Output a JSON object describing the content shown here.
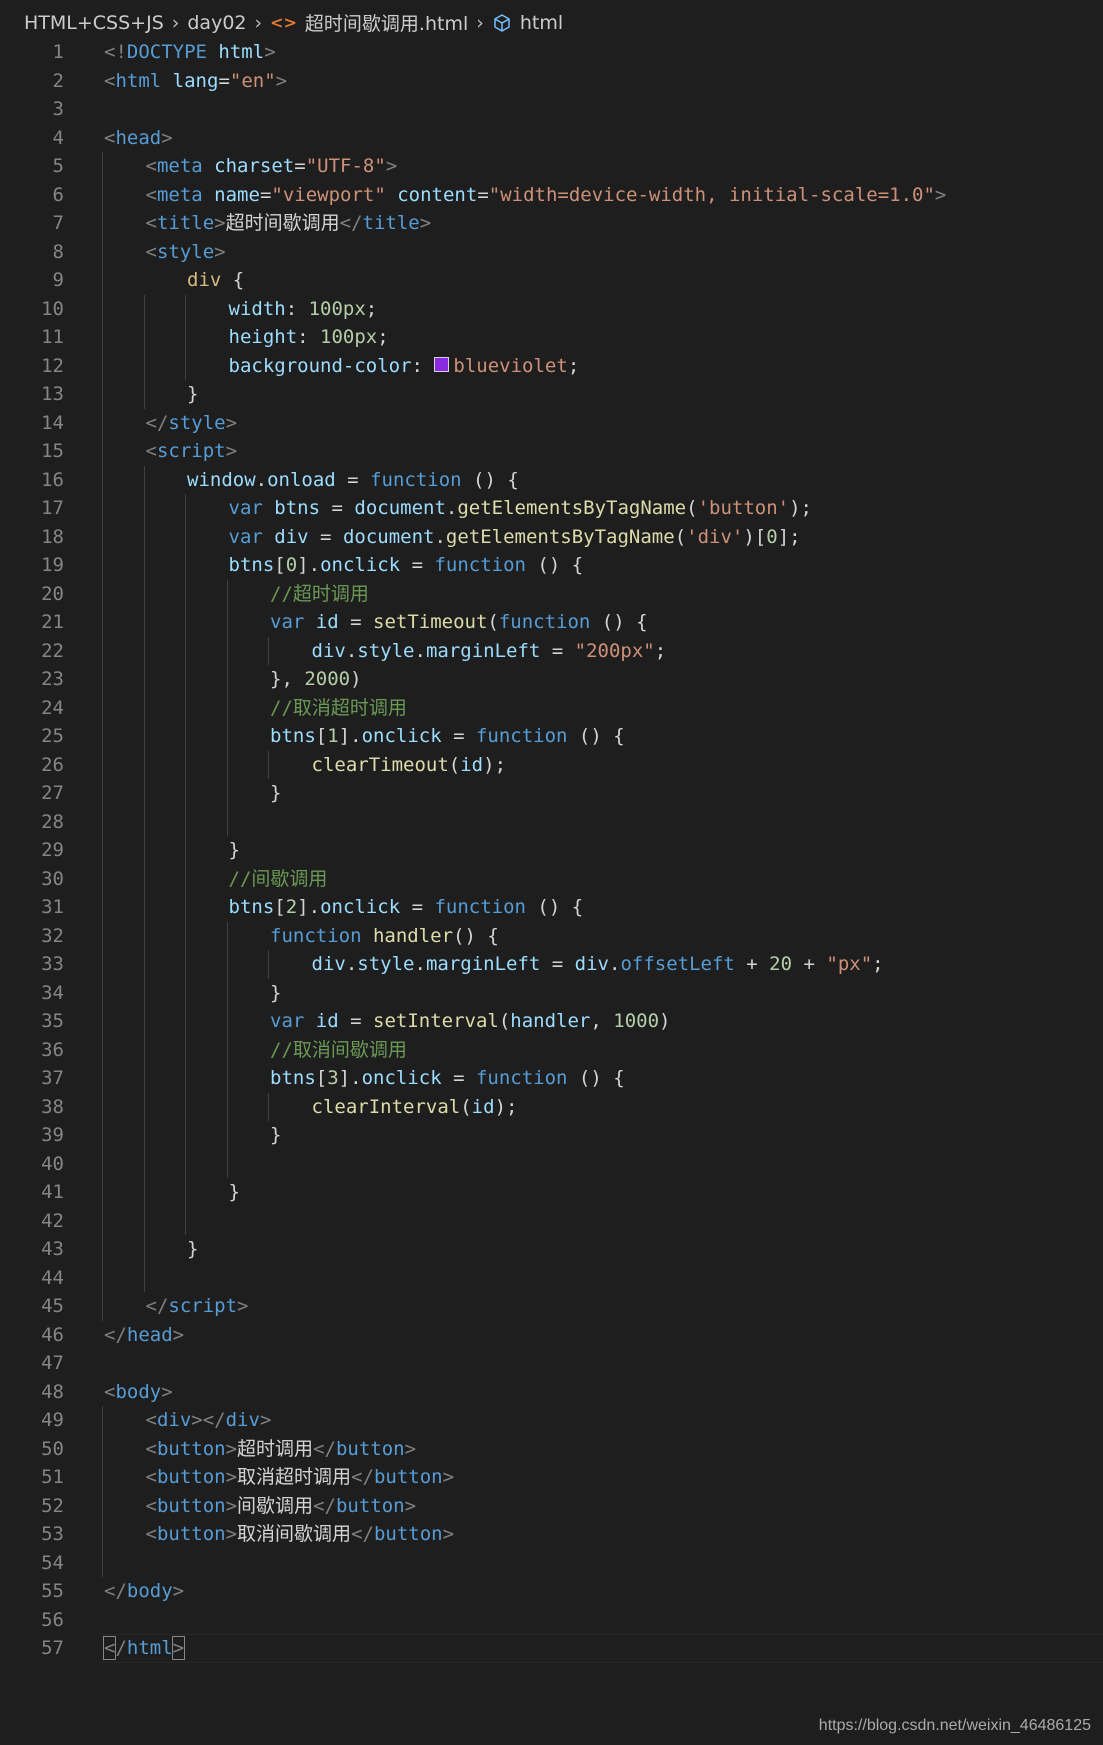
{
  "breadcrumb": {
    "items": [
      "HTML+CSS+JS",
      "day02",
      "超时间歇调用.html",
      "html"
    ],
    "file_icon": "html-file-icon",
    "symbol_icon": "cube-symbol-icon"
  },
  "editor": {
    "language": "html",
    "swatch_color": "#8a2be2",
    "lines": [
      {
        "n": "1"
      },
      {
        "n": "2"
      },
      {
        "n": "3"
      },
      {
        "n": "4"
      },
      {
        "n": "5"
      },
      {
        "n": "6"
      },
      {
        "n": "7"
      },
      {
        "n": "8"
      },
      {
        "n": "9"
      },
      {
        "n": "10"
      },
      {
        "n": "11"
      },
      {
        "n": "12"
      },
      {
        "n": "13"
      },
      {
        "n": "14"
      },
      {
        "n": "15"
      },
      {
        "n": "16"
      },
      {
        "n": "17"
      },
      {
        "n": "18"
      },
      {
        "n": "19"
      },
      {
        "n": "20"
      },
      {
        "n": "21"
      },
      {
        "n": "22"
      },
      {
        "n": "23"
      },
      {
        "n": "24"
      },
      {
        "n": "25"
      },
      {
        "n": "26"
      },
      {
        "n": "27"
      },
      {
        "n": "28"
      },
      {
        "n": "29"
      },
      {
        "n": "30"
      },
      {
        "n": "31"
      },
      {
        "n": "32"
      },
      {
        "n": "33"
      },
      {
        "n": "34"
      },
      {
        "n": "35"
      },
      {
        "n": "36"
      },
      {
        "n": "37"
      },
      {
        "n": "38"
      },
      {
        "n": "39"
      },
      {
        "n": "40"
      },
      {
        "n": "41"
      },
      {
        "n": "42"
      },
      {
        "n": "43"
      },
      {
        "n": "44"
      },
      {
        "n": "45"
      },
      {
        "n": "46"
      },
      {
        "n": "47"
      },
      {
        "n": "48"
      },
      {
        "n": "49"
      },
      {
        "n": "50"
      },
      {
        "n": "51"
      },
      {
        "n": "52"
      },
      {
        "n": "53"
      },
      {
        "n": "54"
      },
      {
        "n": "55"
      },
      {
        "n": "56"
      },
      {
        "n": "57"
      }
    ],
    "code": {
      "l1": [
        [
          "p",
          "<!"
        ],
        [
          "k",
          "DOCTYPE"
        ],
        [
          "txt",
          " "
        ],
        [
          "a",
          "html"
        ],
        [
          "p",
          ">"
        ]
      ],
      "l2": [
        [
          "p",
          "<"
        ],
        [
          "t",
          "html"
        ],
        [
          "txt",
          " "
        ],
        [
          "a",
          "lang"
        ],
        [
          "txt",
          "="
        ],
        [
          "s",
          "\"en\""
        ],
        [
          "p",
          ">"
        ]
      ],
      "l3": [],
      "l4": [
        [
          "p",
          "<"
        ],
        [
          "t",
          "head"
        ],
        [
          "p",
          ">"
        ]
      ],
      "l5": [
        [
          "p",
          "<"
        ],
        [
          "t",
          "meta"
        ],
        [
          "txt",
          " "
        ],
        [
          "a",
          "charset"
        ],
        [
          "txt",
          "="
        ],
        [
          "s",
          "\"UTF-8\""
        ],
        [
          "p",
          ">"
        ]
      ],
      "l6": [
        [
          "p",
          "<"
        ],
        [
          "t",
          "meta"
        ],
        [
          "txt",
          " "
        ],
        [
          "a",
          "name"
        ],
        [
          "txt",
          "="
        ],
        [
          "s",
          "\"viewport\""
        ],
        [
          "txt",
          " "
        ],
        [
          "a",
          "content"
        ],
        [
          "txt",
          "="
        ],
        [
          "s",
          "\"width=device-width, initial-scale=1.0\""
        ],
        [
          "p",
          ">"
        ]
      ],
      "l7": [
        [
          "p",
          "<"
        ],
        [
          "t",
          "title"
        ],
        [
          "p",
          ">"
        ],
        [
          "txt",
          "超时间歇调用"
        ],
        [
          "p",
          "</"
        ],
        [
          "t",
          "title"
        ],
        [
          "p",
          ">"
        ]
      ],
      "l8": [
        [
          "p",
          "<"
        ],
        [
          "t",
          "style"
        ],
        [
          "p",
          ">"
        ]
      ],
      "l9": [
        [
          "sel",
          "div"
        ],
        [
          "txt",
          " {"
        ]
      ],
      "l10": [
        [
          "a",
          "width"
        ],
        [
          "txt",
          ": "
        ],
        [
          "n",
          "100px"
        ],
        [
          "txt",
          ";"
        ]
      ],
      "l11": [
        [
          "a",
          "height"
        ],
        [
          "txt",
          ": "
        ],
        [
          "n",
          "100px"
        ],
        [
          "txt",
          ";"
        ]
      ],
      "l12": [
        [
          "a",
          "background-color"
        ],
        [
          "txt",
          ": "
        ],
        [
          "swatch",
          ""
        ],
        [
          "s",
          "blueviolet"
        ],
        [
          "txt",
          ";"
        ]
      ],
      "l13": [
        [
          "txt",
          "}"
        ]
      ],
      "l14": [
        [
          "p",
          "</"
        ],
        [
          "t",
          "style"
        ],
        [
          "p",
          ">"
        ]
      ],
      "l15": [
        [
          "p",
          "<"
        ],
        [
          "t",
          "script"
        ],
        [
          "p",
          ">"
        ]
      ],
      "l16": [
        [
          "v",
          "window"
        ],
        [
          "txt",
          "."
        ],
        [
          "v",
          "onload"
        ],
        [
          "txt",
          " = "
        ],
        [
          "k",
          "function"
        ],
        [
          "txt",
          " () {"
        ]
      ],
      "l17": [
        [
          "k",
          "var"
        ],
        [
          "txt",
          " "
        ],
        [
          "v",
          "btns"
        ],
        [
          "txt",
          " = "
        ],
        [
          "v",
          "document"
        ],
        [
          "txt",
          "."
        ],
        [
          "f",
          "getElementsByTagName"
        ],
        [
          "txt",
          "("
        ],
        [
          "s",
          "'button'"
        ],
        [
          "txt",
          ");"
        ]
      ],
      "l18": [
        [
          "k",
          "var"
        ],
        [
          "txt",
          " "
        ],
        [
          "v",
          "div"
        ],
        [
          "txt",
          " = "
        ],
        [
          "v",
          "document"
        ],
        [
          "txt",
          "."
        ],
        [
          "f",
          "getElementsByTagName"
        ],
        [
          "txt",
          "("
        ],
        [
          "s",
          "'div'"
        ],
        [
          "txt",
          ")["
        ],
        [
          "n",
          "0"
        ],
        [
          "txt",
          "];"
        ]
      ],
      "l19": [
        [
          "v",
          "btns"
        ],
        [
          "txt",
          "["
        ],
        [
          "n",
          "0"
        ],
        [
          "txt",
          "]."
        ],
        [
          "v",
          "onclick"
        ],
        [
          "txt",
          " = "
        ],
        [
          "k",
          "function"
        ],
        [
          "txt",
          " () {"
        ]
      ],
      "l20": [
        [
          "c",
          "//超时调用"
        ]
      ],
      "l21": [
        [
          "k",
          "var"
        ],
        [
          "txt",
          " "
        ],
        [
          "v",
          "id"
        ],
        [
          "txt",
          " = "
        ],
        [
          "f",
          "setTimeout"
        ],
        [
          "txt",
          "("
        ],
        [
          "k",
          "function"
        ],
        [
          "txt",
          " () {"
        ]
      ],
      "l22": [
        [
          "v",
          "div"
        ],
        [
          "txt",
          "."
        ],
        [
          "v",
          "style"
        ],
        [
          "txt",
          "."
        ],
        [
          "v",
          "marginLeft"
        ],
        [
          "txt",
          " = "
        ],
        [
          "s",
          "\"200px\""
        ],
        [
          "txt",
          ";"
        ]
      ],
      "l23": [
        [
          "txt",
          "}, "
        ],
        [
          "n",
          "2000"
        ],
        [
          "txt",
          ")"
        ]
      ],
      "l24": [
        [
          "c",
          "//取消超时调用"
        ]
      ],
      "l25": [
        [
          "v",
          "btns"
        ],
        [
          "txt",
          "["
        ],
        [
          "n",
          "1"
        ],
        [
          "txt",
          "]."
        ],
        [
          "v",
          "onclick"
        ],
        [
          "txt",
          " = "
        ],
        [
          "k",
          "function"
        ],
        [
          "txt",
          " () {"
        ]
      ],
      "l26": [
        [
          "f",
          "clearTimeout"
        ],
        [
          "txt",
          "("
        ],
        [
          "v",
          "id"
        ],
        [
          "txt",
          ");"
        ]
      ],
      "l27": [
        [
          "txt",
          "}"
        ]
      ],
      "l28": [],
      "l29": [
        [
          "txt",
          "}"
        ]
      ],
      "l30": [
        [
          "c",
          "//间歇调用"
        ]
      ],
      "l31": [
        [
          "v",
          "btns"
        ],
        [
          "txt",
          "["
        ],
        [
          "n",
          "2"
        ],
        [
          "txt",
          "]."
        ],
        [
          "v",
          "onclick"
        ],
        [
          "txt",
          " = "
        ],
        [
          "k",
          "function"
        ],
        [
          "txt",
          " () {"
        ]
      ],
      "l32": [
        [
          "k",
          "function"
        ],
        [
          "txt",
          " "
        ],
        [
          "f",
          "handler"
        ],
        [
          "txt",
          "() {"
        ]
      ],
      "l33": [
        [
          "v",
          "div"
        ],
        [
          "txt",
          "."
        ],
        [
          "v",
          "style"
        ],
        [
          "txt",
          "."
        ],
        [
          "v",
          "marginLeft"
        ],
        [
          "txt",
          " = "
        ],
        [
          "v",
          "div"
        ],
        [
          "txt",
          "."
        ],
        [
          "k",
          "offsetLeft"
        ],
        [
          "txt",
          " + "
        ],
        [
          "n",
          "20"
        ],
        [
          "txt",
          " + "
        ],
        [
          "s",
          "\"px\""
        ],
        [
          "txt",
          ";"
        ]
      ],
      "l34": [
        [
          "txt",
          "}"
        ]
      ],
      "l35": [
        [
          "k",
          "var"
        ],
        [
          "txt",
          " "
        ],
        [
          "v",
          "id"
        ],
        [
          "txt",
          " = "
        ],
        [
          "f",
          "setInterval"
        ],
        [
          "txt",
          "("
        ],
        [
          "v",
          "handler"
        ],
        [
          "txt",
          ", "
        ],
        [
          "n",
          "1000"
        ],
        [
          "txt",
          ")"
        ]
      ],
      "l36": [
        [
          "c",
          "//取消间歇调用"
        ]
      ],
      "l37": [
        [
          "v",
          "btns"
        ],
        [
          "txt",
          "["
        ],
        [
          "n",
          "3"
        ],
        [
          "txt",
          "]."
        ],
        [
          "v",
          "onclick"
        ],
        [
          "txt",
          " = "
        ],
        [
          "k",
          "function"
        ],
        [
          "txt",
          " () {"
        ]
      ],
      "l38": [
        [
          "f",
          "clearInterval"
        ],
        [
          "txt",
          "("
        ],
        [
          "v",
          "id"
        ],
        [
          "txt",
          ");"
        ]
      ],
      "l39": [
        [
          "txt",
          "}"
        ]
      ],
      "l40": [],
      "l41": [
        [
          "txt",
          "}"
        ]
      ],
      "l42": [],
      "l43": [
        [
          "txt",
          "}"
        ]
      ],
      "l44": [],
      "l45": [
        [
          "p",
          "</"
        ],
        [
          "t",
          "script"
        ],
        [
          "p",
          ">"
        ]
      ],
      "l46": [
        [
          "p",
          "</"
        ],
        [
          "t",
          "head"
        ],
        [
          "p",
          ">"
        ]
      ],
      "l47": [],
      "l48": [
        [
          "p",
          "<"
        ],
        [
          "t",
          "body"
        ],
        [
          "p",
          ">"
        ]
      ],
      "l49": [
        [
          "p",
          "<"
        ],
        [
          "t",
          "div"
        ],
        [
          "p",
          "></"
        ],
        [
          "t",
          "div"
        ],
        [
          "p",
          ">"
        ]
      ],
      "l50": [
        [
          "p",
          "<"
        ],
        [
          "t",
          "button"
        ],
        [
          "p",
          ">"
        ],
        [
          "txt",
          "超时调用"
        ],
        [
          "p",
          "</"
        ],
        [
          "t",
          "button"
        ],
        [
          "p",
          ">"
        ]
      ],
      "l51": [
        [
          "p",
          "<"
        ],
        [
          "t",
          "button"
        ],
        [
          "p",
          ">"
        ],
        [
          "txt",
          "取消超时调用"
        ],
        [
          "p",
          "</"
        ],
        [
          "t",
          "button"
        ],
        [
          "p",
          ">"
        ]
      ],
      "l52": [
        [
          "p",
          "<"
        ],
        [
          "t",
          "button"
        ],
        [
          "p",
          ">"
        ],
        [
          "txt",
          "间歇调用"
        ],
        [
          "p",
          "</"
        ],
        [
          "t",
          "button"
        ],
        [
          "p",
          ">"
        ]
      ],
      "l53": [
        [
          "p",
          "<"
        ],
        [
          "t",
          "button"
        ],
        [
          "p",
          ">"
        ],
        [
          "txt",
          "取消间歇调用"
        ],
        [
          "p",
          "</"
        ],
        [
          "t",
          "button"
        ],
        [
          "p",
          ">"
        ]
      ],
      "l54": [],
      "l55": [
        [
          "p",
          "</"
        ],
        [
          "t",
          "body"
        ],
        [
          "p",
          ">"
        ]
      ],
      "l56": [],
      "l57": [
        [
          "bl",
          "<"
        ],
        [
          "p",
          "/"
        ],
        [
          "t",
          "html"
        ],
        [
          "br",
          ">"
        ]
      ]
    }
  },
  "watermark": "https://blog.csdn.net/weixin_46486125"
}
